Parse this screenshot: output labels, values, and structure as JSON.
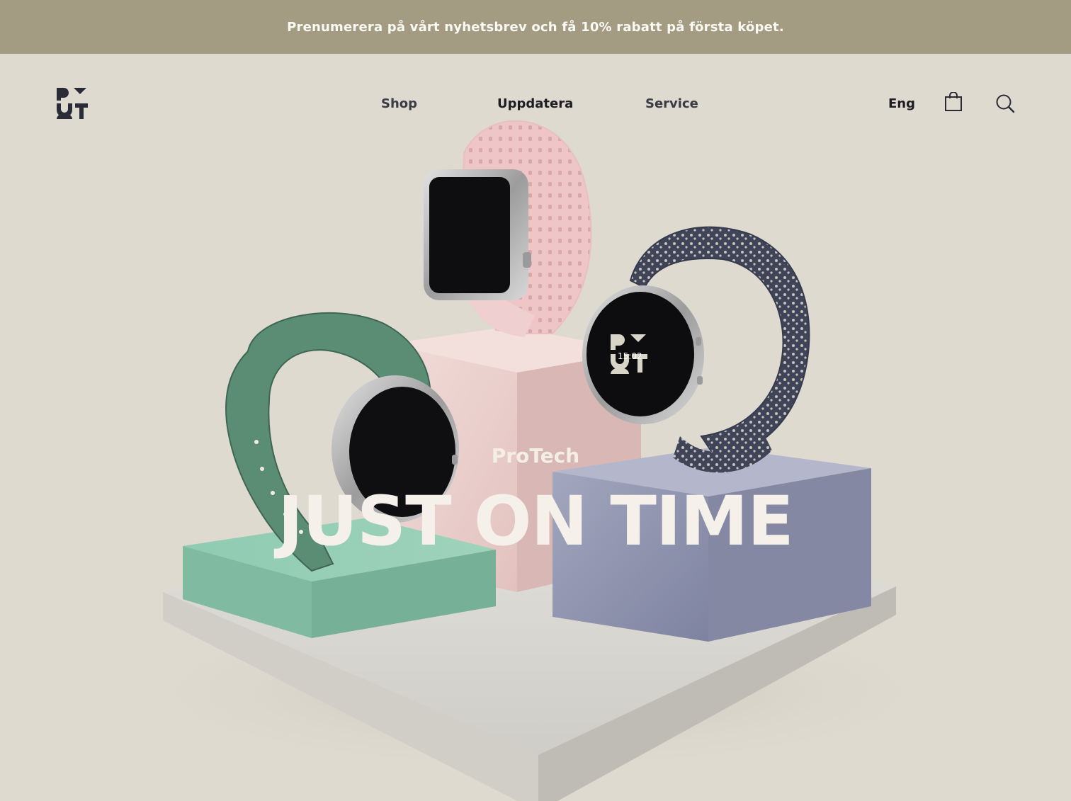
{
  "promo": {
    "text": "Prenumerera på vårt nyhetsbrev och få 10% rabatt på första köpet."
  },
  "brand": {
    "logo_icon": "pout-logo"
  },
  "nav": {
    "items": [
      {
        "label": "Shop",
        "active": false
      },
      {
        "label": "Uppdatera",
        "active": true
      },
      {
        "label": "Service",
        "active": false
      }
    ]
  },
  "header": {
    "language": "Eng",
    "cart_icon": "shopping-bag-icon",
    "search_icon": "search-icon"
  },
  "hero": {
    "kicker": "ProTech",
    "headline": "JUST ON TIME",
    "watch_face_time": "15:02"
  },
  "colors": {
    "promo_bg": "#a39c83",
    "page_bg": "#dedad0",
    "text_dark": "#1c1c22",
    "mint": "#8dc4ac",
    "pink": "#f0d2cf",
    "lavender": "#9397b0",
    "green_band": "#5a8a73",
    "navy_band": "#3d4255"
  }
}
